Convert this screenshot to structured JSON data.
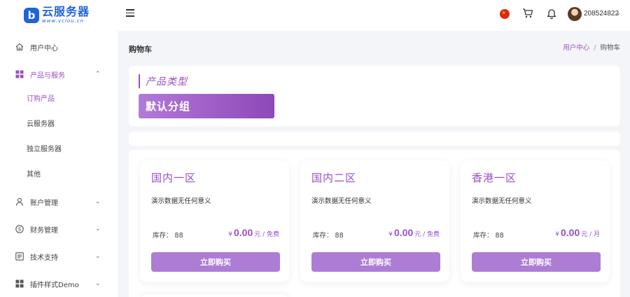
{
  "header": {
    "logo_badge": "b",
    "logo_title": "云服务器",
    "logo_sub": "www.vclou.cn",
    "username": "208524822"
  },
  "sidebar": {
    "items": [
      {
        "label": "用户中心",
        "icon": "home-icon"
      },
      {
        "label": "产品与服务",
        "icon": "grid-icon",
        "chevron": "⌃"
      },
      {
        "label": "账户管理",
        "icon": "user-icon",
        "chevron": "⌄"
      },
      {
        "label": "财务管理",
        "icon": "dollar-icon",
        "chevron": "⌄"
      },
      {
        "label": "技术支持",
        "icon": "list-icon",
        "chevron": "⌄"
      },
      {
        "label": "插件样式Demo",
        "icon": "grid-icon",
        "chevron": "⌄"
      }
    ],
    "sub_items": [
      {
        "label": "订购产品"
      },
      {
        "label": "云服务器"
      },
      {
        "label": "独立服务器"
      },
      {
        "label": "其他"
      }
    ]
  },
  "page": {
    "title": "购物车",
    "breadcrumb_home": "用户中心",
    "breadcrumb_sep": "/",
    "breadcrumb_current": "购物车"
  },
  "product_type": {
    "heading": "产品类型",
    "group_button": "默认分组"
  },
  "products": [
    {
      "name": "国内一区",
      "desc": "演示数据无任何意义",
      "stock_label": "库存：",
      "stock": "88",
      "currency": "¥",
      "price": "0.00",
      "unit": "元 / 免费",
      "buy": "立即购买"
    },
    {
      "name": "国内二区",
      "desc": "演示数据无任何意义",
      "stock_label": "库存：",
      "stock": "88",
      "currency": "¥",
      "price": "0.00",
      "unit": "元 / 免费",
      "buy": "立即购买"
    },
    {
      "name": "香港一区",
      "desc": "演示数据无任何意义",
      "stock_label": "库存：",
      "stock": "88",
      "currency": "¥",
      "price": "0.00",
      "unit": "元 / 月",
      "buy": "立即购买"
    }
  ],
  "colors": {
    "accent": "#9b4fc4",
    "brand": "#1f64d8",
    "button": "#ad7dd6"
  }
}
